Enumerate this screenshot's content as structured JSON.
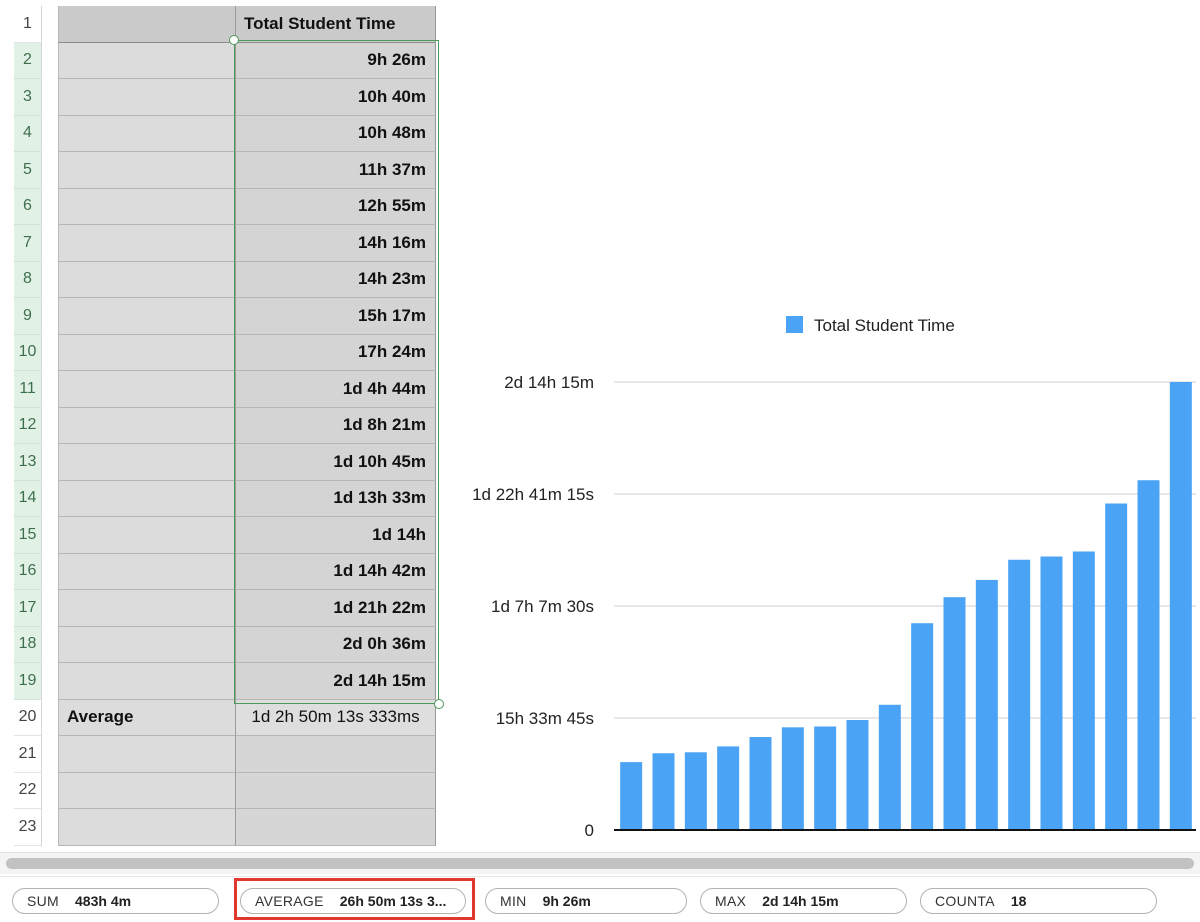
{
  "row_numbers": [
    "1",
    "2",
    "3",
    "4",
    "5",
    "6",
    "7",
    "8",
    "9",
    "10",
    "11",
    "12",
    "13",
    "14",
    "15",
    "16",
    "17",
    "18",
    "19",
    "20",
    "21",
    "22",
    "23"
  ],
  "table": {
    "header_b": "Total Student Time",
    "times": [
      "9h 26m",
      "10h 40m",
      "10h 48m",
      "11h 37m",
      "12h 55m",
      "14h 16m",
      "14h 23m",
      "15h 17m",
      "17h 24m",
      "1d 4h 44m",
      "1d 8h 21m",
      "1d 10h 45m",
      "1d 13h 33m",
      "1d 14h",
      "1d 14h 42m",
      "1d 21h 22m",
      "2d 0h 36m",
      "2d 14h 15m"
    ],
    "average_label": "Average",
    "average_value": "1d 2h 50m 13s 333ms"
  },
  "chart_data": {
    "type": "bar",
    "legend": [
      "Total Student Time"
    ],
    "legend_position": "top",
    "series": [
      {
        "name": "Total Student Time",
        "values_minutes": [
          566,
          640,
          648,
          697,
          775,
          856,
          863,
          917,
          1044,
          1724,
          1941,
          2085,
          2253,
          2280,
          2322,
          2722,
          2916,
          3735
        ],
        "color": "#4aa3f5"
      }
    ],
    "y_ticks": [
      "0",
      "15h 33m 45s",
      "1d 7h 7m 30s",
      "1d 22h 41m 15s",
      "2d 14h 15m"
    ],
    "y_tick_minutes": [
      0,
      933.75,
      1867.5,
      2801.25,
      3735
    ],
    "ylim_minutes": [
      0,
      3735
    ],
    "grid": true
  },
  "statusbar": {
    "sum_label": "SUM",
    "sum_value": "483h 4m",
    "avg_label": "AVERAGE",
    "avg_value": "26h 50m 13s 3...",
    "min_label": "MIN",
    "min_value": "9h 26m",
    "max_label": "MAX",
    "max_value": "2d 14h 15m",
    "counta_label": "COUNTA",
    "counta_value": "18"
  },
  "colors": {
    "bar": "#4aa3f5",
    "selection": "#4b9a5c",
    "highlight": "#e0382d"
  }
}
